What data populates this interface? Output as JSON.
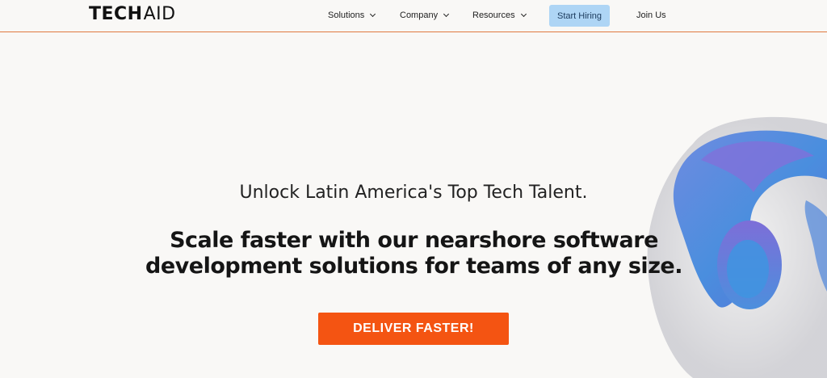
{
  "brand": {
    "logo_part1": "TECH",
    "logo_part2": "AID",
    "accent": "#f45412"
  },
  "nav": {
    "items": [
      {
        "label": "Solutions",
        "has_dropdown": true
      },
      {
        "label": "Company",
        "has_dropdown": true
      },
      {
        "label": "Resources",
        "has_dropdown": true
      }
    ],
    "start_hiring": "Start Hiring",
    "join_us": "Join Us"
  },
  "hero": {
    "tagline": "Unlock Latin America's Top Tech Talent.",
    "headline_line1": "Scale faster with our nearshore software",
    "headline_line2": "development solutions for teams of any size.",
    "cta": "DELIVER FASTER!"
  }
}
